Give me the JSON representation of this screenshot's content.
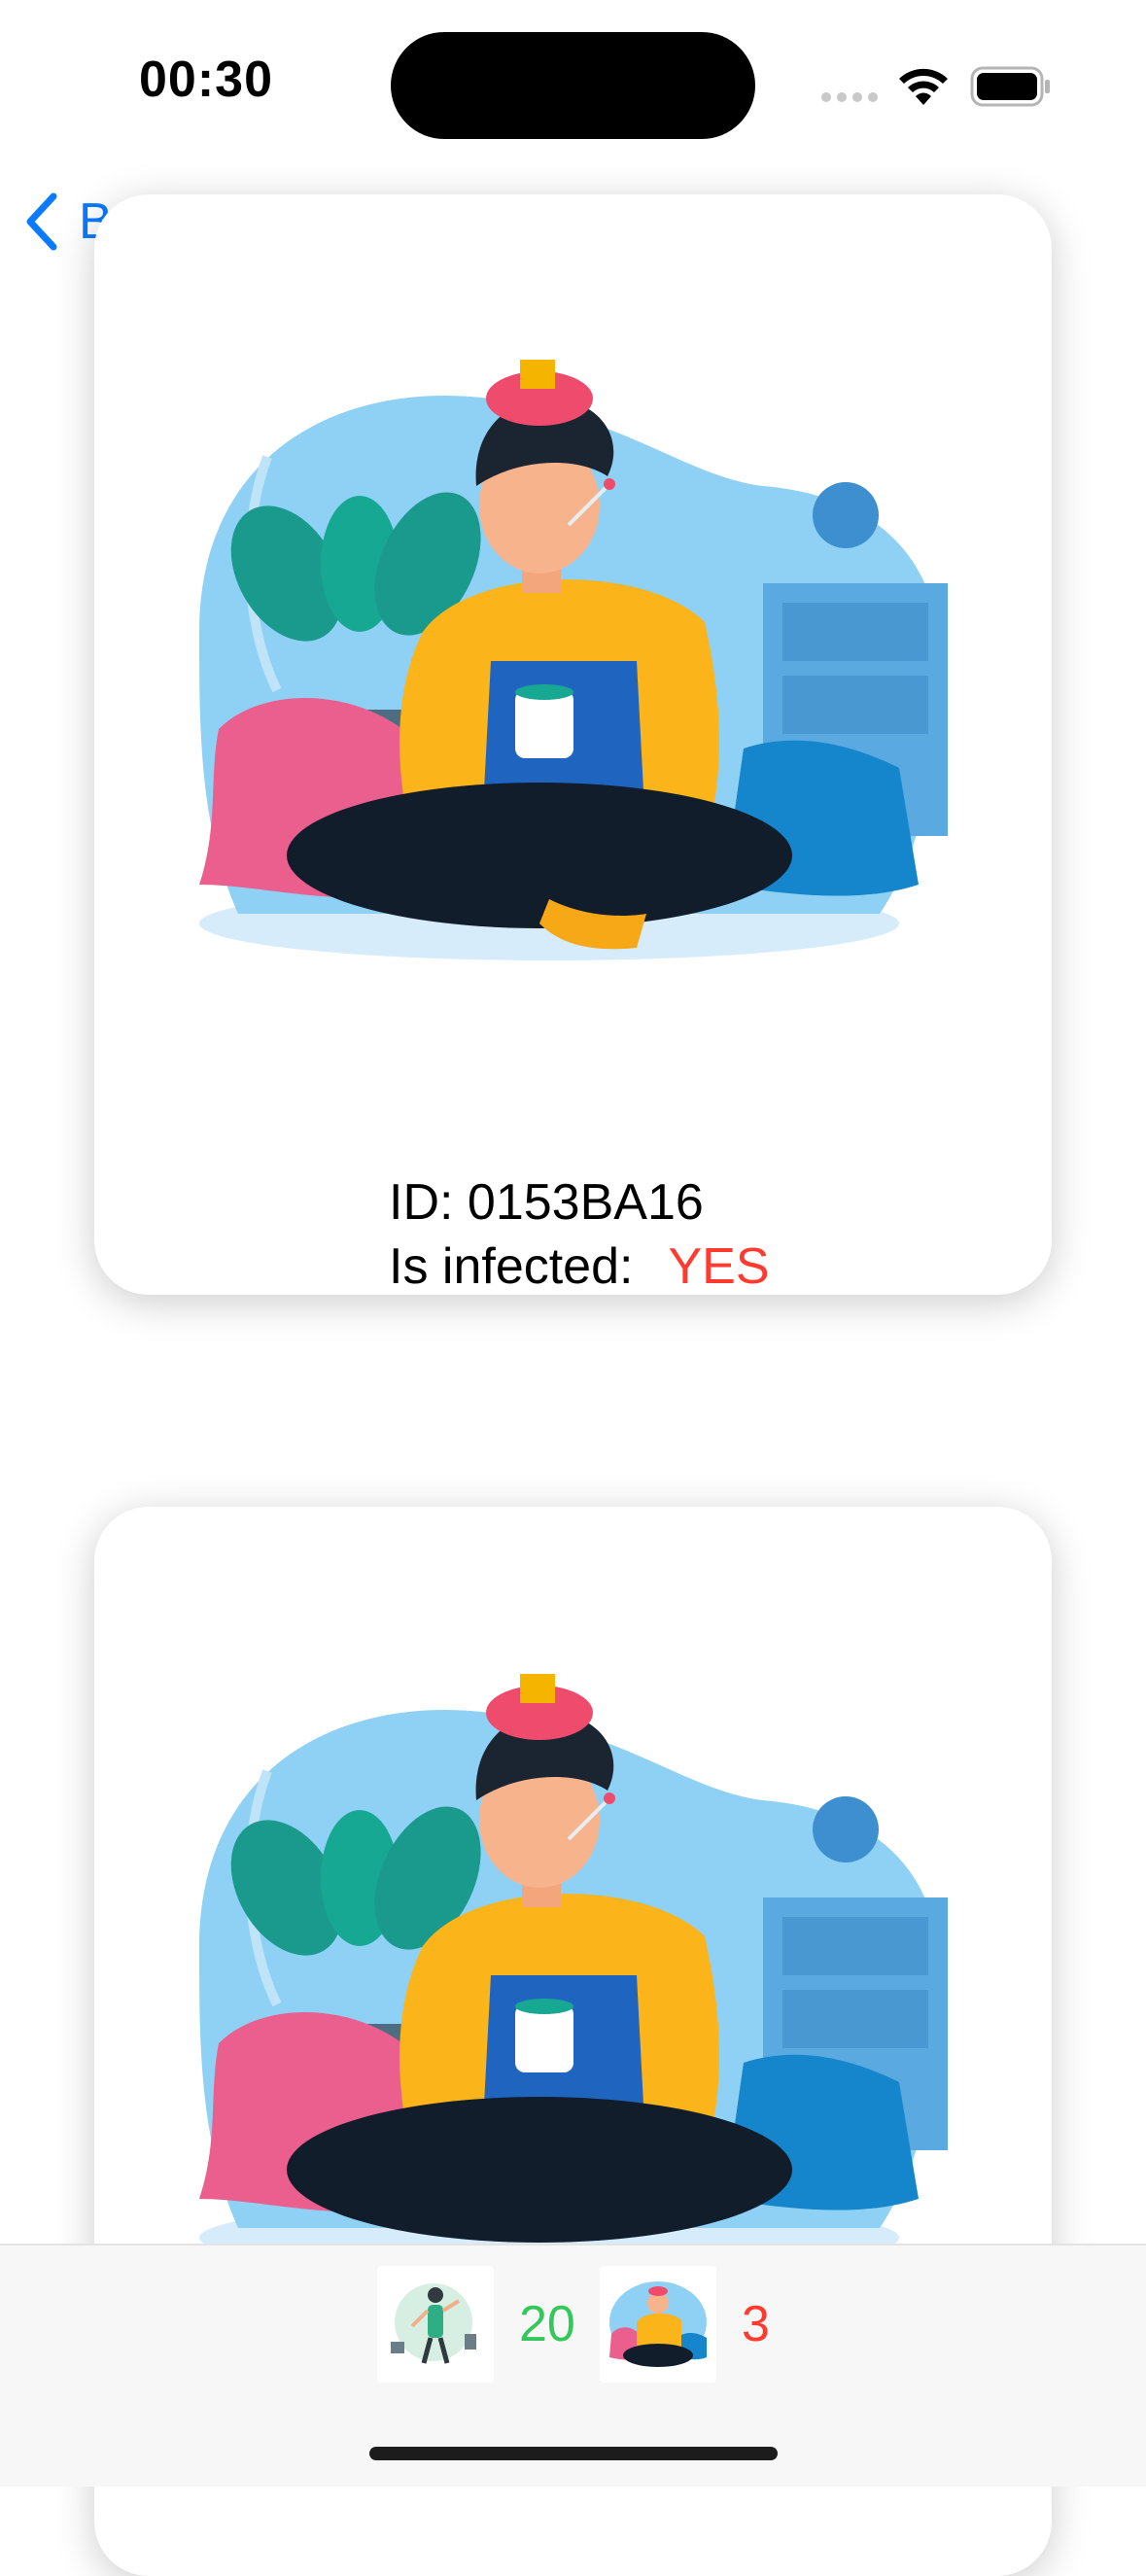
{
  "status_bar": {
    "time": "00:30"
  },
  "nav": {
    "back_label": "Back"
  },
  "cards": [
    {
      "id_label": "ID: 0153BA16",
      "infected_label": "Is infected:",
      "infected_value": "YES"
    },
    {
      "id_label": "",
      "infected_label": "",
      "infected_value": ""
    }
  ],
  "tabbar": {
    "healthy_count": "20",
    "infected_count": "3",
    "colors": {
      "healthy": "#34c759",
      "infected": "#ff3b30"
    }
  },
  "colors": {
    "accent": "#0a7aff"
  }
}
